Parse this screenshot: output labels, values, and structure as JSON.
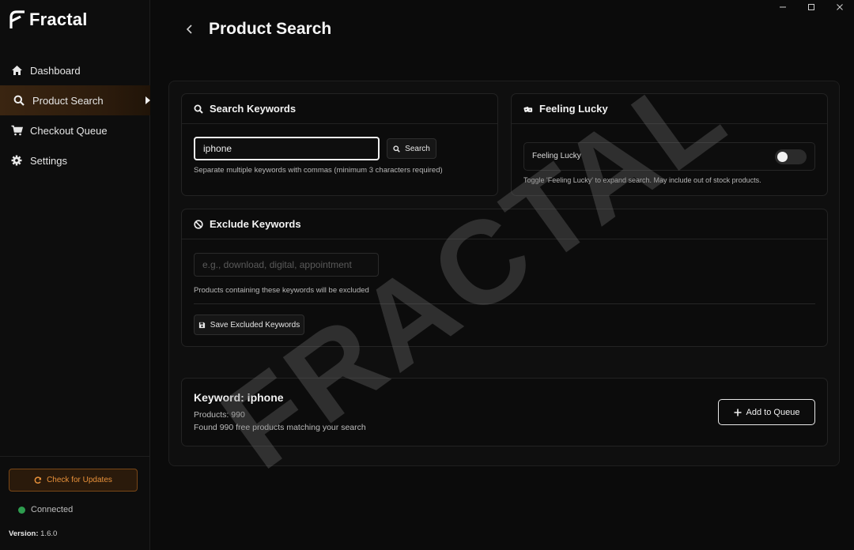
{
  "app": {
    "name": "Fractal",
    "watermark": "FRACTAL"
  },
  "sidebar": {
    "items": [
      {
        "label": "Dashboard",
        "icon": "home-icon"
      },
      {
        "label": "Product Search",
        "icon": "search-icon",
        "active": true
      },
      {
        "label": "Checkout Queue",
        "icon": "cart-icon"
      },
      {
        "label": "Settings",
        "icon": "gear-icon"
      }
    ],
    "update_button": "Check for Updates",
    "status": "Connected",
    "version_label": "Version:",
    "version_value": "1.6.0"
  },
  "header": {
    "title": "Product Search"
  },
  "search": {
    "title": "Search Keywords",
    "value": "iphone",
    "button": "Search",
    "hint": "Separate multiple keywords with commas (minimum 3 characters required)"
  },
  "lucky": {
    "title": "Feeling Lucky",
    "toggle_label": "Feeling Lucky",
    "hint": "Toggle 'Feeling Lucky' to expand search. May include out of stock products.",
    "enabled": false
  },
  "exclude": {
    "title": "Exclude Keywords",
    "placeholder": "e.g., download, digital, appointment",
    "hint": "Products containing these keywords will be excluded",
    "button": "Save Excluded Keywords"
  },
  "result": {
    "title": "Keyword: iphone",
    "products": "Products: 990",
    "found": "Found 990 free products matching your search",
    "button": "Add to Queue"
  },
  "colors": {
    "accent": "#e8913a",
    "connected": "#2e9d4f"
  }
}
